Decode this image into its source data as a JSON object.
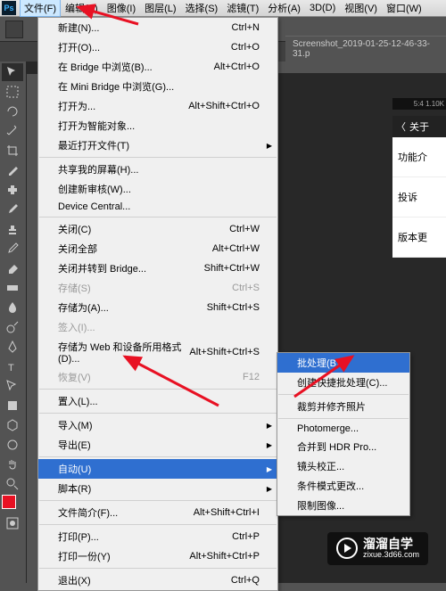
{
  "menubar": {
    "items": [
      "文件(F)",
      "编辑(E)",
      "图像(I)",
      "图层(L)",
      "选择(S)",
      "滤镜(T)",
      "分析(A)",
      "3D(D)",
      "视图(V)",
      "窗口(W)"
    ]
  },
  "tab_title": "Screenshot_2019-01-25-12-46-33-31.p",
  "file_menu": [
    {
      "label": "新建(N)...",
      "sc": "Ctrl+N"
    },
    {
      "label": "打开(O)...",
      "sc": "Ctrl+O"
    },
    {
      "label": "在 Bridge 中浏览(B)...",
      "sc": "Alt+Ctrl+O"
    },
    {
      "label": "在 Mini Bridge 中浏览(G)...",
      "sc": ""
    },
    {
      "label": "打开为...",
      "sc": "Alt+Shift+Ctrl+O"
    },
    {
      "label": "打开为智能对象...",
      "sc": ""
    },
    {
      "label": "最近打开文件(T)",
      "sc": "",
      "sub": true
    },
    {
      "sep": true
    },
    {
      "label": "共享我的屏幕(H)...",
      "sc": ""
    },
    {
      "label": "创建新审核(W)...",
      "sc": ""
    },
    {
      "label": "Device Central...",
      "sc": ""
    },
    {
      "sep": true
    },
    {
      "label": "关闭(C)",
      "sc": "Ctrl+W"
    },
    {
      "label": "关闭全部",
      "sc": "Alt+Ctrl+W"
    },
    {
      "label": "关闭并转到 Bridge...",
      "sc": "Shift+Ctrl+W"
    },
    {
      "label": "存储(S)",
      "sc": "Ctrl+S",
      "dis": true
    },
    {
      "label": "存储为(A)...",
      "sc": "Shift+Ctrl+S"
    },
    {
      "label": "签入(I)...",
      "sc": "",
      "dis": true
    },
    {
      "label": "存储为 Web 和设备所用格式(D)...",
      "sc": "Alt+Shift+Ctrl+S"
    },
    {
      "label": "恢复(V)",
      "sc": "F12",
      "dis": true
    },
    {
      "sep": true
    },
    {
      "label": "置入(L)...",
      "sc": ""
    },
    {
      "sep": true
    },
    {
      "label": "导入(M)",
      "sc": "",
      "sub": true
    },
    {
      "label": "导出(E)",
      "sc": "",
      "sub": true
    },
    {
      "sep": true
    },
    {
      "label": "自动(U)",
      "sc": "",
      "sub": true,
      "hl": true
    },
    {
      "label": "脚本(R)",
      "sc": "",
      "sub": true
    },
    {
      "sep": true
    },
    {
      "label": "文件简介(F)...",
      "sc": "Alt+Shift+Ctrl+I"
    },
    {
      "sep": true
    },
    {
      "label": "打印(P)...",
      "sc": "Ctrl+P"
    },
    {
      "label": "打印一份(Y)",
      "sc": "Alt+Shift+Ctrl+P"
    },
    {
      "sep": true
    },
    {
      "label": "退出(X)",
      "sc": "Ctrl+Q"
    }
  ],
  "auto_submenu": [
    {
      "label": "批处理(B)...",
      "hl": true
    },
    {
      "label": "创建快捷批处理(C)..."
    },
    {
      "sep": true
    },
    {
      "label": "裁剪并修齐照片"
    },
    {
      "sep": true
    },
    {
      "label": "Photomerge..."
    },
    {
      "label": "合并到 HDR Pro..."
    },
    {
      "label": "镜头校正..."
    },
    {
      "label": "条件模式更改..."
    },
    {
      "label": "限制图像..."
    }
  ],
  "side": {
    "status": "5:4 1.10K",
    "back": "关于",
    "items": [
      "功能介",
      "投诉",
      "版本更"
    ]
  },
  "watermark": {
    "brand": "溜溜自学",
    "url": "zixue.3d66.com"
  }
}
